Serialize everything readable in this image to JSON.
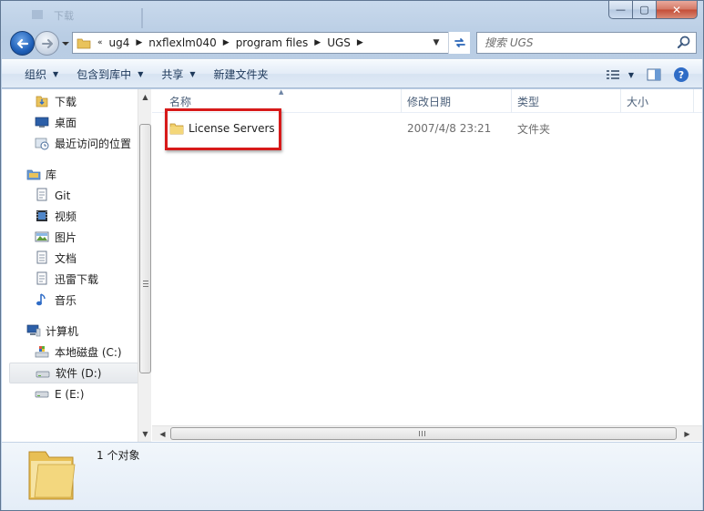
{
  "window": {
    "faded_title": "下载",
    "controls": {
      "minimize": "—",
      "maximize": "▢",
      "close": "✕"
    }
  },
  "address": {
    "overflow": "«",
    "crumbs": [
      "ug4",
      "nxflexlm040",
      "program files",
      "UGS"
    ]
  },
  "search": {
    "placeholder": "搜索 UGS"
  },
  "toolbar": {
    "organize": "组织",
    "include_in_library": "包含到库中",
    "share": "共享",
    "new_folder": "新建文件夹"
  },
  "sidebar": {
    "favorites": [
      {
        "label": "下载",
        "icon": "downloads-folder-icon"
      },
      {
        "label": "桌面",
        "icon": "desktop-icon"
      },
      {
        "label": "最近访问的位置",
        "icon": "recent-places-icon"
      }
    ],
    "libraries_label": "库",
    "libraries": [
      {
        "label": "Git",
        "icon": "document-library-icon"
      },
      {
        "label": "视频",
        "icon": "video-library-icon"
      },
      {
        "label": "图片",
        "icon": "pictures-library-icon"
      },
      {
        "label": "文档",
        "icon": "documents-library-icon"
      },
      {
        "label": "迅雷下载",
        "icon": "document-library-icon"
      },
      {
        "label": "音乐",
        "icon": "music-library-icon"
      }
    ],
    "computer_label": "计算机",
    "drives": [
      {
        "label": "本地磁盘 (C:)",
        "icon": "system-drive-icon"
      },
      {
        "label": "软件 (D:)",
        "icon": "drive-icon",
        "selected": true
      },
      {
        "label": "E (E:)",
        "icon": "drive-icon"
      }
    ]
  },
  "columns": {
    "name": "名称",
    "date": "修改日期",
    "type": "类型",
    "size": "大小"
  },
  "files": [
    {
      "name": "License Servers",
      "date": "2007/4/8 23:21",
      "type": "文件夹",
      "size": ""
    }
  ],
  "details": {
    "count": "1 个对象"
  },
  "colors": {
    "highlight": "#d71a1a",
    "chrome": "#c3d5ea"
  }
}
